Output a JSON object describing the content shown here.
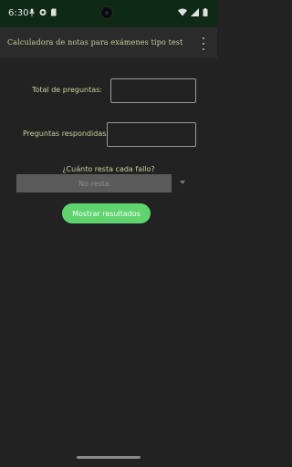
{
  "status_bar": {
    "time": "6:30"
  },
  "app_bar": {
    "title": "Calculadora de notas para exámenes tipo test"
  },
  "form": {
    "total_label": "Total de preguntas:",
    "total_value": "",
    "answered_label": "Preguntas respondidas:",
    "answered_value": "",
    "penalty_question": "¿Cuánto resta cada fallo?",
    "penalty_selected": "No resta",
    "submit_label": "Mostrar resultados"
  },
  "colors": {
    "accent_green": "#5fd36e",
    "status_bar_bg": "#0f2a14",
    "app_bar_bg": "#2b2b2b",
    "background": "#222222",
    "label_text": "#c9d39e"
  }
}
